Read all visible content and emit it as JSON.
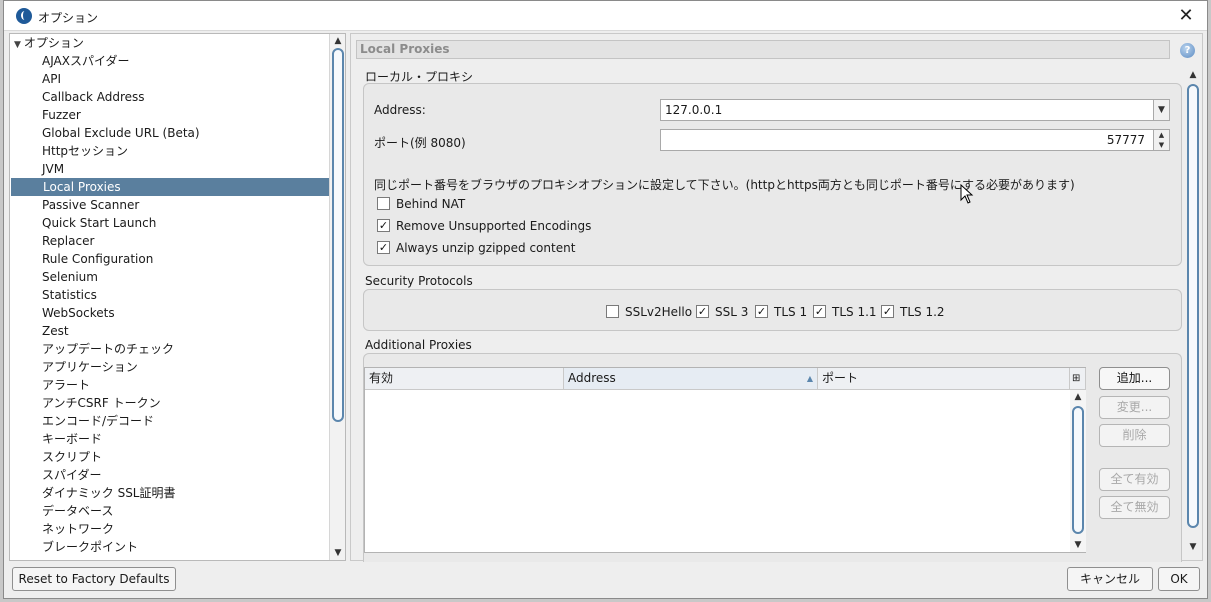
{
  "window": {
    "title": "オプション"
  },
  "tree": {
    "root": "オプション",
    "items": [
      "AJAXスパイダー",
      "API",
      "Callback Address",
      "Fuzzer",
      "Global Exclude URL (Beta)",
      "Httpセッション",
      "JVM",
      "Local Proxies",
      "Passive Scanner",
      "Quick Start Launch",
      "Replacer",
      "Rule Configuration",
      "Selenium",
      "Statistics",
      "WebSockets",
      "Zest",
      "アップデートのチェック",
      "アプリケーション",
      "アラート",
      "アンチCSRF トークン",
      "エンコード/デコード",
      "キーボード",
      "スクリプト",
      "スパイダー",
      "ダイナミック SSL証明書",
      "データベース",
      "ネットワーク",
      "ブレークポイント"
    ],
    "selected": "Local Proxies"
  },
  "panel": {
    "header": "Local Proxies",
    "local_proxy_section": "ローカル・プロキシ",
    "address_label": "Address:",
    "address_value": "127.0.0.1",
    "port_label": "ポート(例 8080)",
    "port_value": "57777",
    "note": "同じポート番号をブラウザのプロキシオプションに設定して下さい。(httpとhttps両方とも同じポート番号にする必要があります)",
    "options": [
      {
        "label": "Behind NAT",
        "checked": false
      },
      {
        "label": "Remove Unsupported Encodings",
        "checked": true
      },
      {
        "label": "Always unzip gzipped content",
        "checked": true
      }
    ],
    "security_section": "Security Protocols",
    "protocols": [
      {
        "label": "SSLv2Hello",
        "checked": false
      },
      {
        "label": "SSL 3",
        "checked": true
      },
      {
        "label": "TLS 1",
        "checked": true
      },
      {
        "label": "TLS 1.1",
        "checked": true
      },
      {
        "label": "TLS 1.2",
        "checked": true
      }
    ],
    "additional_section": "Additional Proxies",
    "table_columns": [
      "有効",
      "Address",
      "ポート"
    ],
    "buttons": {
      "add": "追加...",
      "modify": "変更...",
      "remove": "削除",
      "enable_all": "全て有効",
      "disable_all": "全て無効"
    }
  },
  "footer": {
    "reset": "Reset to Factory Defaults",
    "cancel": "キャンセル",
    "ok": "OK"
  }
}
